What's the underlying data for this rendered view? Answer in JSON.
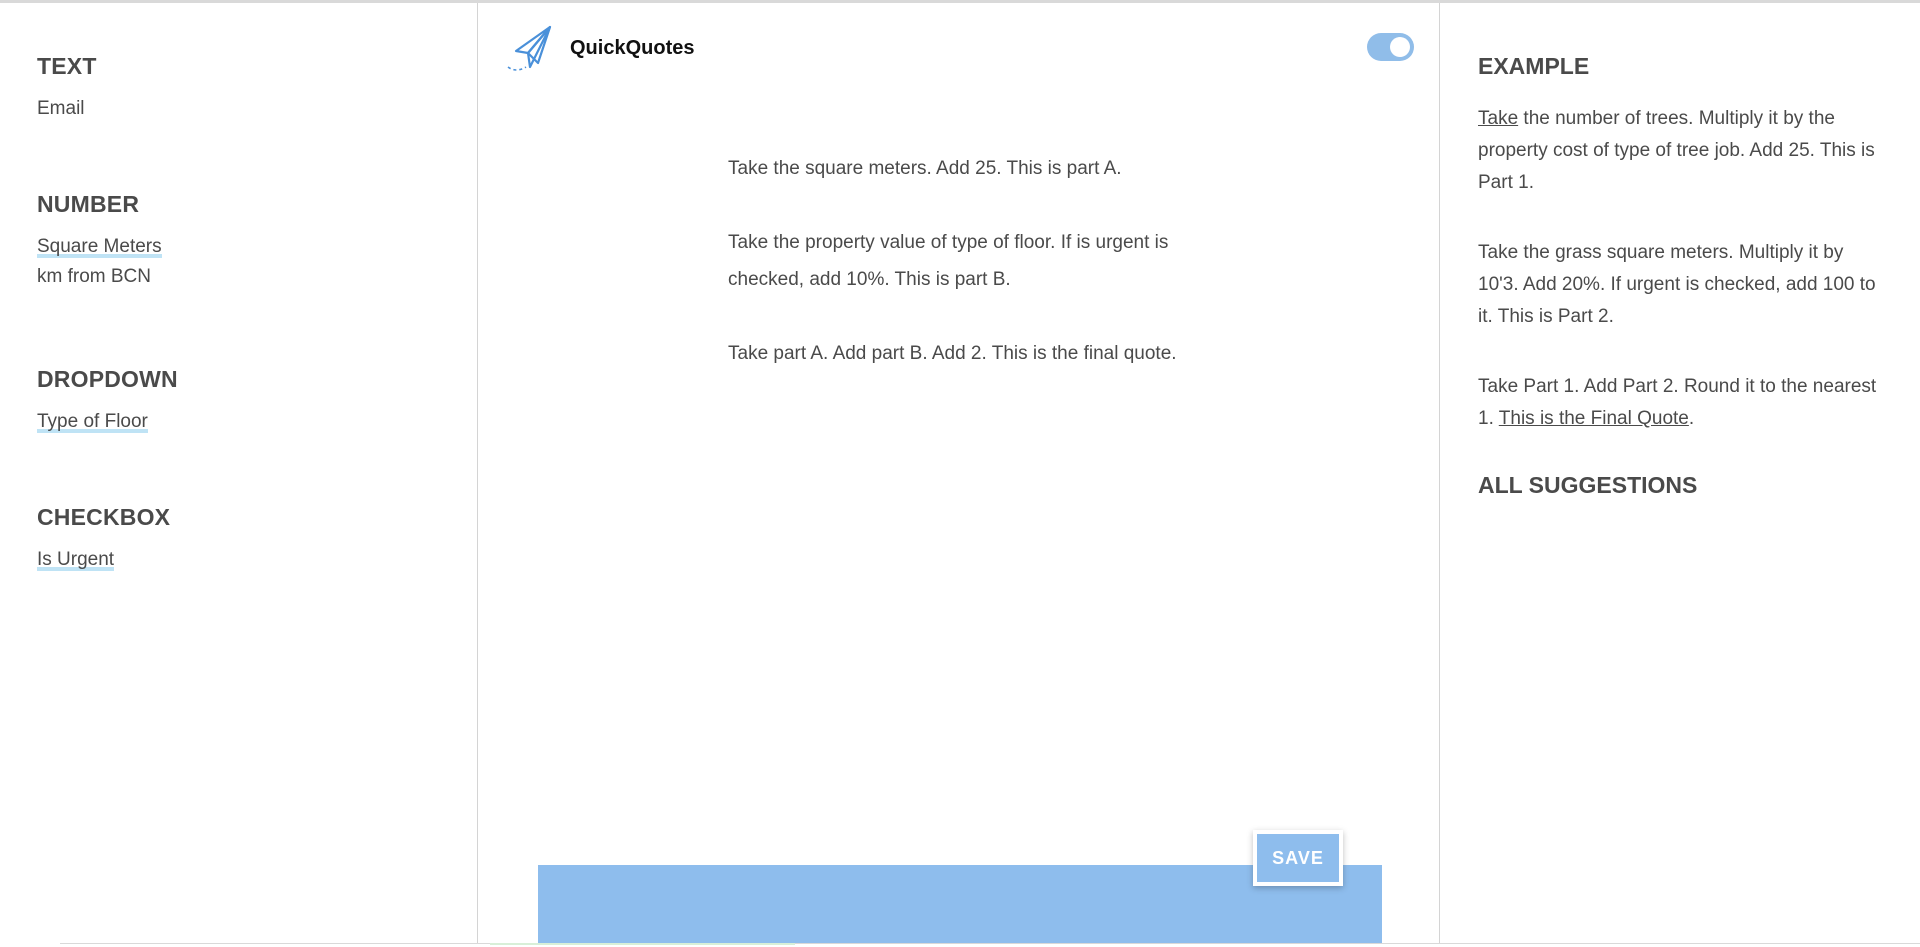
{
  "left_panel": {
    "text_section": {
      "title": "TEXT",
      "fields": [
        "Email"
      ]
    },
    "number_section": {
      "title": "NUMBER",
      "fields": [
        "Square Meters",
        "km from BCN"
      ]
    },
    "dropdown_section": {
      "title": "DROPDOWN",
      "fields": [
        "Type of Floor"
      ]
    },
    "checkbox_section": {
      "title": "CHECKBOX",
      "fields": [
        "Is Urgent"
      ]
    }
  },
  "header": {
    "brand": "QuickQuotes",
    "logo_icon": "paper-plane-icon",
    "toggle_on": true
  },
  "editor": {
    "paragraphs": [
      "Take the square meters. Add 25. This is part A.",
      "Take the property value of type of floor. If is urgent is checked, add 10%. This is part B.",
      "Take part A. Add part B. Add 2. This is the final quote."
    ]
  },
  "save_label": "SAVE",
  "right_panel": {
    "example_title": "EXAMPLE",
    "example_p1_link": "Take",
    "example_p1_rest": " the number of trees. Multiply it by the property cost of type of tree job. Add 25. This is Part 1.",
    "example_p2": "Take the grass square meters. Multiply it by 10'3. Add 20%. If urgent is checked, add 100 to it. This is Part 2.",
    "example_p3_start": "Take Part 1. Add Part 2. Round it to the nearest 1. ",
    "example_p3_link": "This is the Final Quote",
    "example_p3_end": ".",
    "suggestions_title": "ALL SUGGESTIONS"
  },
  "colors": {
    "accent": "#8ebded",
    "highlight": "#bfe3f5",
    "text": "#4a4a4a"
  }
}
